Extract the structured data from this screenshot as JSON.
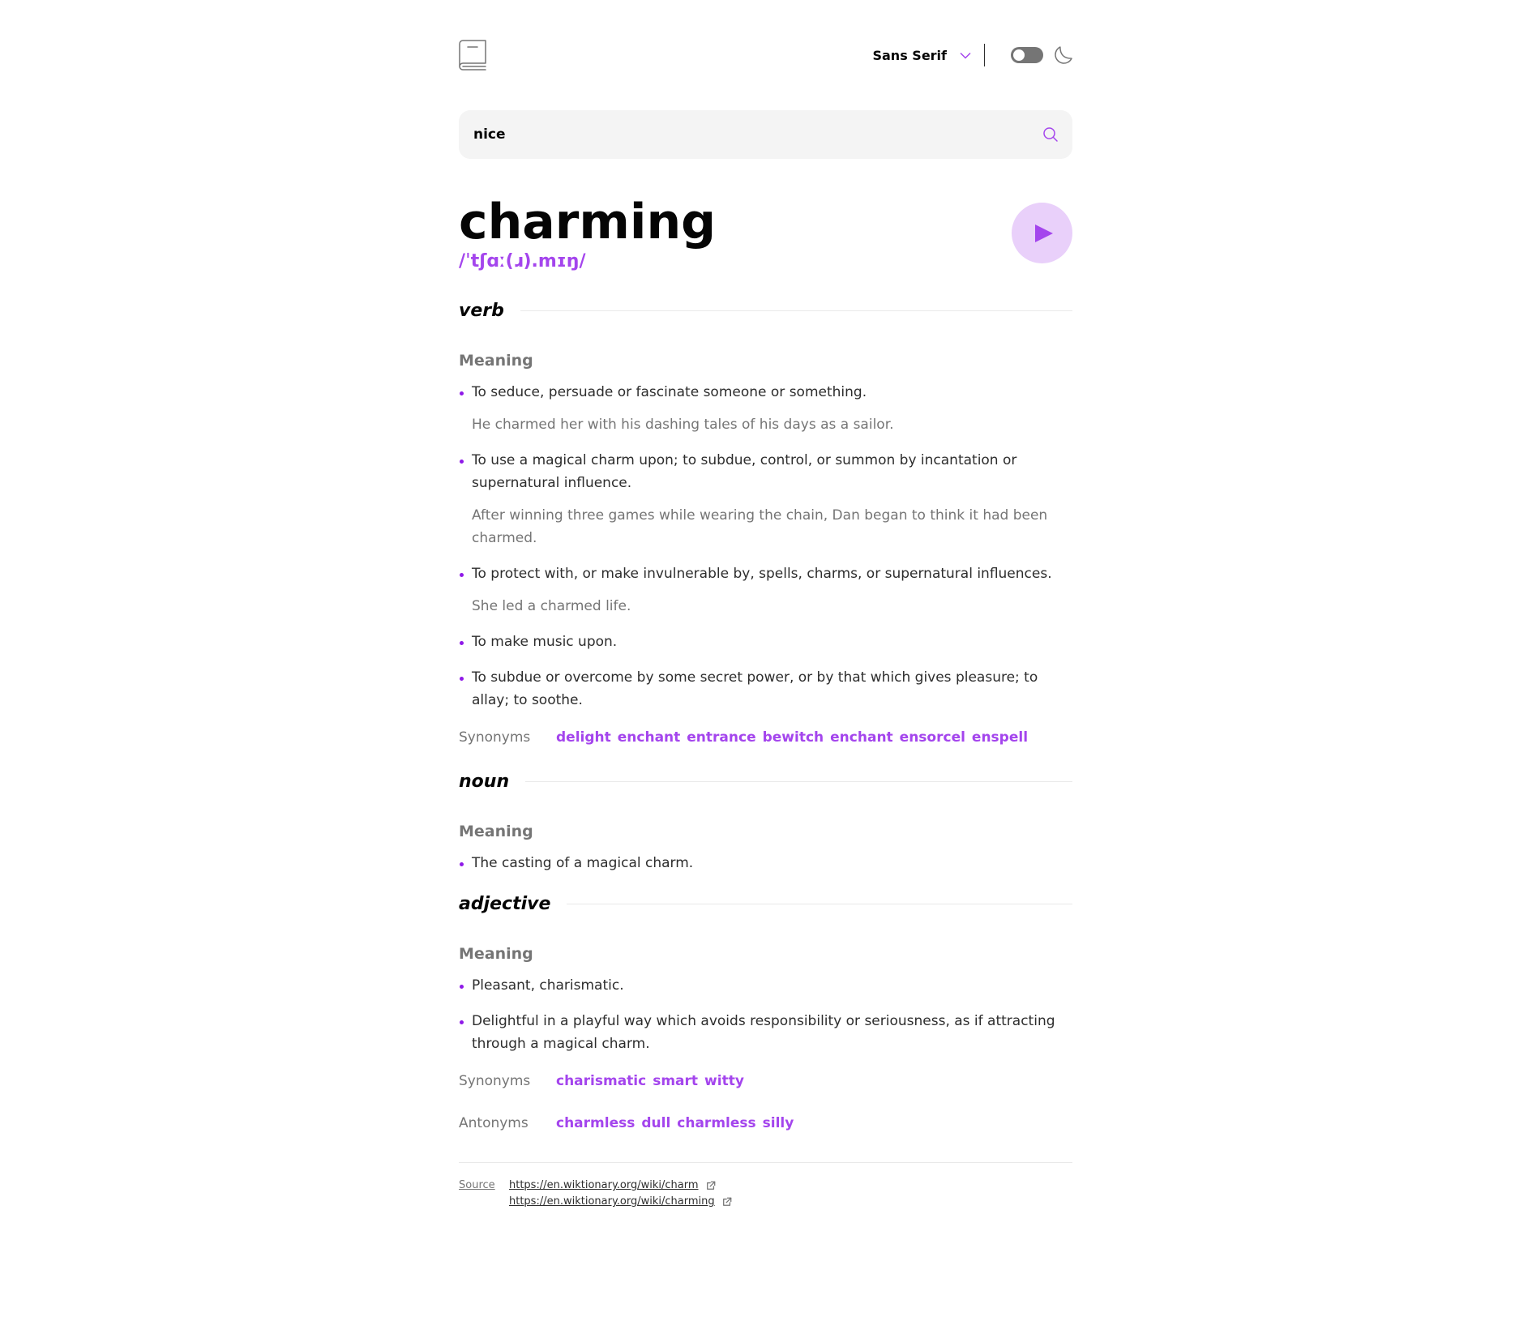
{
  "header": {
    "font_selected": "Sans Serif"
  },
  "search": {
    "value": "nice"
  },
  "word": {
    "term": "charming",
    "phonetic": "/ˈtʃɑː(ɹ).mɪŋ/"
  },
  "meanings": [
    {
      "part_of_speech": "verb",
      "heading": "Meaning",
      "definitions": [
        {
          "text": "To seduce, persuade or fascinate someone or something.",
          "example": "He charmed her with his dashing tales of his days as a sailor."
        },
        {
          "text": "To use a magical charm upon; to subdue, control, or summon by incantation or supernatural influence.",
          "example": "After winning three games while wearing the chain, Dan began to think it had been charmed."
        },
        {
          "text": "To protect with, or make invulnerable by, spells, charms, or supernatural influences.",
          "example": "She led a charmed life."
        },
        {
          "text": "To make music upon."
        },
        {
          "text": "To subdue or overcome by some secret power, or by that which gives pleasure; to allay; to soothe."
        }
      ],
      "synonyms_label": "Synonyms",
      "synonyms": [
        "delight",
        "enchant",
        "entrance",
        "bewitch",
        "enchant",
        "ensorcel",
        "enspell"
      ]
    },
    {
      "part_of_speech": "noun",
      "heading": "Meaning",
      "definitions": [
        {
          "text": "The casting of a magical charm."
        }
      ]
    },
    {
      "part_of_speech": "adjective",
      "heading": "Meaning",
      "definitions": [
        {
          "text": "Pleasant, charismatic."
        },
        {
          "text": "Delightful in a playful way which avoids responsibility or seriousness, as if attracting through a magical charm."
        }
      ],
      "synonyms_label": "Synonyms",
      "synonyms": [
        "charismatic",
        "smart",
        "witty"
      ],
      "antonyms_label": "Antonyms",
      "antonyms": [
        "charmless",
        "dull",
        "charmless",
        "silly"
      ]
    }
  ],
  "source": {
    "label": "Source",
    "links": [
      "https://en.wiktionary.org/wiki/charm",
      "https://en.wiktionary.org/wiki/charming"
    ]
  },
  "icons": {
    "logo": "book-icon",
    "font_dropdown": "chevron-down-icon",
    "theme": "moon-icon",
    "search": "search-icon",
    "play": "play-icon",
    "external": "external-link-icon"
  },
  "colors": {
    "accent": "#a445ed",
    "play_bg": "#e9d0fa",
    "muted": "#757575"
  }
}
